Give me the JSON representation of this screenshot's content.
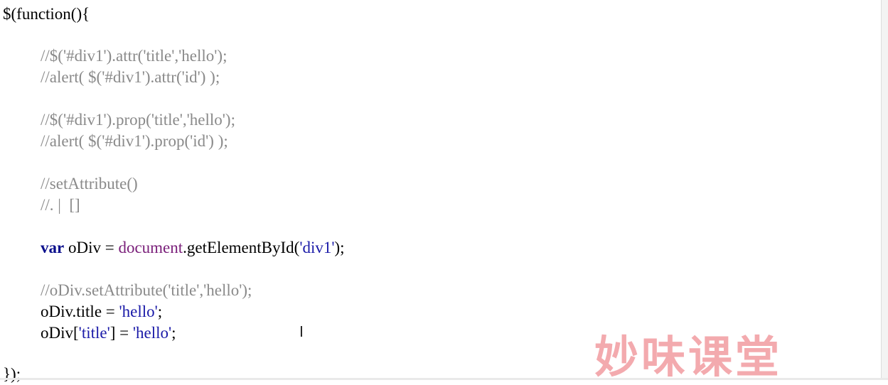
{
  "code": {
    "l1": "$(function(){",
    "l2": "//$('#div1').attr('title','hello');",
    "l3": "//alert( $('#div1').attr('id') );",
    "l4": "//$('#div1').prop('title','hello');",
    "l5": "//alert( $('#div1').prop('id') );",
    "l6": "//setAttribute()",
    "l7": "//. |  []",
    "l8_kw": "var",
    "l8_a": " oDiv = ",
    "l8_doc": "document",
    "l8_b": ".getElementById(",
    "l8_str": "'div1'",
    "l8_c": ");",
    "l9": "//oDiv.setAttribute('title','hello');",
    "l10_a": "oDiv.title = ",
    "l10_str": "'hello'",
    "l10_b": ";",
    "l11_a": "oDiv[",
    "l11_str1": "'title'",
    "l11_b": "] = ",
    "l11_str2": "'hello'",
    "l11_c": ";",
    "l12": "});"
  },
  "cursor_glyph": "I",
  "watermark": "妙味课堂",
  "colors": {
    "comment": "#8a8a8a",
    "keyword": "#0a0f8c",
    "string": "#1a1aa8",
    "document": "#7a1f7a",
    "watermark": "#f2a3a8"
  }
}
